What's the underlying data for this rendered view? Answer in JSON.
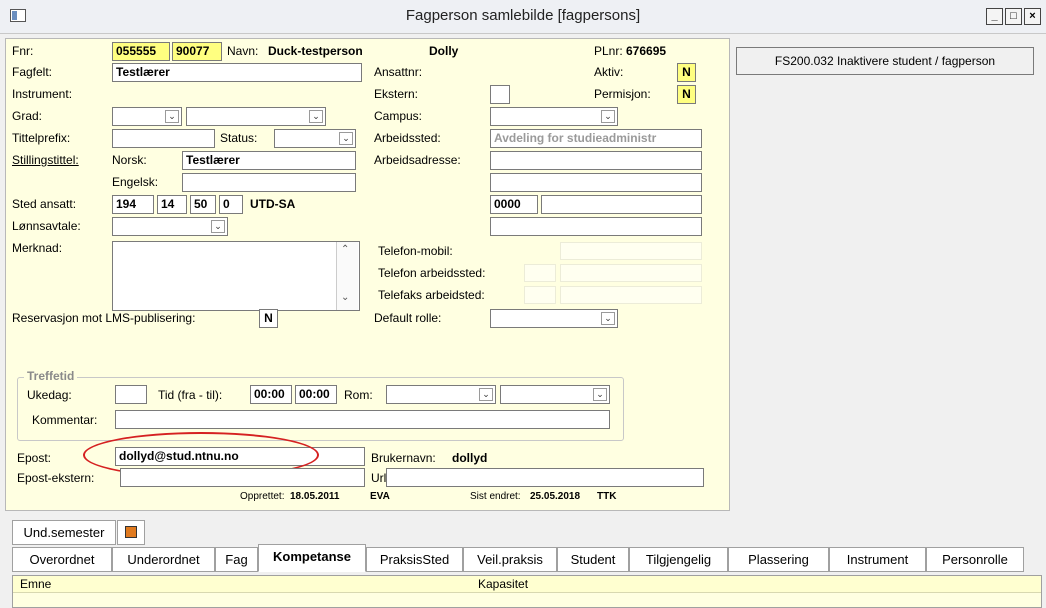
{
  "window": {
    "title": "Fagperson samlebilde  [fagpersons]",
    "minimize": "_",
    "maximize": "□",
    "close": "×"
  },
  "form": {
    "fnr_label": "Fnr:",
    "fnr_part1": "055555",
    "fnr_part2": "90077",
    "navn_label": "Navn:",
    "navn_last": "Duck-testperson",
    "navn_first": "Dolly",
    "plnr_label": "PLnr:",
    "plnr_value": "676695",
    "fagfelt_label": "Fagfelt:",
    "fagfelt_value": "Testlærer",
    "ansattnr_label": "Ansattnr:",
    "aktiv_label": "Aktiv:",
    "aktiv_value": "N",
    "instrument_label": "Instrument:",
    "ekstern_label": "Ekstern:",
    "permisjon_label": "Permisjon:",
    "permisjon_value": "N",
    "grad_label": "Grad:",
    "campus_label": "Campus:",
    "tittelprefix_label": "Tittelprefix:",
    "status_label": "Status:",
    "arbeidssted_label": "Arbeidssted:",
    "arbeidssted_value": "Avdeling for studieadministr",
    "stillingstittel_label": "Stillingstittel:",
    "norsk_label": "Norsk:",
    "norsk_value": "Testlærer",
    "arbeidsadresse_label": "Arbeidsadresse:",
    "engelsk_label": "Engelsk:",
    "sted_ansatt_label": "Sted ansatt:",
    "sted_1": "194",
    "sted_2": "14",
    "sted_3": "50",
    "sted_4": "0",
    "sted_name": "UTD-SA",
    "postnr_value": "0000",
    "lonnsavtale_label": "Lønnsavtale:",
    "merknad_label": "Merknad:",
    "telefon_mobil_label": "Telefon-mobil:",
    "telefon_arbeidssted_label": "Telefon arbeidssted:",
    "telefaks_arbeidsted_label": "Telefaks arbeidsted:",
    "reservasjon_label": "Reservasjon mot LMS-publisering:",
    "reservasjon_value": "N",
    "default_rolle_label": "Default rolle:",
    "treffetid_legend": "Treffetid",
    "ukedag_label": "Ukedag:",
    "tid_label": "Tid (fra - til):",
    "tid_fra": "00:00",
    "tid_til": "00:00",
    "rom_label": "Rom:",
    "kommentar_label": "Kommentar:",
    "epost_label": "Epost:",
    "epost_value": "dollyd@stud.ntnu.no",
    "brukernavn_label": "Brukernavn:",
    "brukernavn_value": "dollyd",
    "epost_ekstern_label": "Epost-ekstern:",
    "url_label": "Url:",
    "opprettet_label": "Opprettet:",
    "opprettet_date": "18.05.2011",
    "opprettet_by": "EVA",
    "sist_endret_label": "Sist endret:",
    "sist_endret_date": "25.05.2018",
    "sist_endret_by": "TTK"
  },
  "side": {
    "inaktivere_button": "FS200.032 Inaktivere student / fagperson"
  },
  "tabs_row1": [
    "Und.semester"
  ],
  "tabs_row2": [
    "Overordnet",
    "Underordnet",
    "Fag",
    "Kompetanse",
    "PraksisSted",
    "Veil.praksis",
    "Student",
    "Tilgjengelig",
    "Plassering",
    "Instrument",
    "Personrolle"
  ],
  "active_tab": "Kompetanse",
  "grid": {
    "col_emne": "Emne",
    "col_kapasitet": "Kapasitet"
  },
  "colors": {
    "form_bg": "#ffffe1",
    "highlight_yellow": "#ffff80",
    "annotation_red": "#d52121"
  }
}
